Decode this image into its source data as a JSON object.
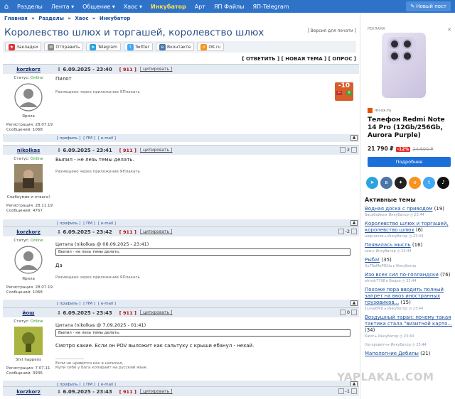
{
  "topbar": {
    "items": [
      "Разделы",
      "Лента ▾",
      "Общение ▾",
      "Хаос ▾",
      "Инкубатор",
      "Арт",
      "ЯП Файлы",
      "ЯП-Telegram"
    ],
    "new_post": "Новый пост",
    "highlight_color": "#ffe14d",
    "bar_color": "#2f73c9"
  },
  "breadcrumbs": [
    "Главная",
    "»",
    "Разделы",
    "»",
    "Хаос",
    "»",
    "Инкубатор"
  ],
  "thread": {
    "title": "Королевство шлюх и торгашей, королевство шлюх",
    "print_link": "[ Версия для печати ]"
  },
  "share": [
    "Закладки",
    "Отправить",
    "Telegram",
    "Twitter",
    "Вконтакте",
    "OK.ru"
  ],
  "actions": "[ ОТВЕТИТЬ ] [ НОВАЯ ТЕМА ] [ ОПРОС ]",
  "posts": [
    {
      "user": "korzkorz",
      "date": "6.09.2025 - 23:40",
      "num": "[ 911 ]",
      "quote_btn": "[ цитировать ]",
      "status_label": "Статус:",
      "status": "Online",
      "caption": "Ярила",
      "reg": "Регистрация: 28.07.19",
      "msgs": "Сообщений: 1068",
      "text": "Пилот",
      "via": "Размещено через приложение  ЯПлакать",
      "rating": "-10"
    },
    {
      "user": "nikolkas",
      "date": "6.09.2025 - 23:41",
      "num": "[ 911 ]",
      "quote_btn": "[ цитировать ]",
      "status_label": "Статус:",
      "status": "Online",
      "caption": "Слабоумие и отвага!",
      "reg": "Регистрация: 28.11.19",
      "msgs": "Сообщений: 4767",
      "text": "Выпил - не лезь темы делать.",
      "via": "Размещено через приложение  ЯПлакать",
      "rating": "2"
    },
    {
      "user": "korzkorz",
      "date": "6.09.2025 - 23:42",
      "num": "[ 911 ]",
      "quote_btn": "[ цитировать ]",
      "status_label": "Статус:",
      "status": "Online",
      "caption": "Ярила",
      "reg": "Регистрация: 28.07.19",
      "msgs": "Сообщений: 1068",
      "quote_head": "Цитата (nikolkas @ 06.09.2025 - 23:41)",
      "quote_text": "Выпил - не лезь темы делать.",
      "text": "Да",
      "via": "Размещено через приложение  ЯПлакать",
      "rating": "-2"
    },
    {
      "user": "йош",
      "date": "6.09.2025 - 23:43",
      "num": "[ 911 ]",
      "quote_btn": "[ цитировать ]",
      "status_label": "Статус:",
      "status": "Online",
      "caption": "Shit happens",
      "reg": "Регистрация: 7.07.11",
      "msgs": "Сообщений: 3936",
      "quote_head": "Цитата (nikolkas @ 7.09.2025 - 01:41)",
      "quote_text": "Выпил - не лезь темы делать.",
      "text": "Смотря какие. Если он POV выложит как сальтуху с крыши ебанул - нехай.",
      "sig1": "--------------------",
      "sig2": "Если не нравится как я написал,",
      "sig3": "Купи себе у Бога копирайт на русский язык.",
      "rating": "0"
    },
    {
      "user": "korzkorz",
      "date": "6.09.2025 - 23:43",
      "num": "[ 911 ]",
      "quote_btn": "[ цитировать ]",
      "rating": "-1"
    }
  ],
  "footer_links": [
    "[ профиль ]",
    "[ ПМ ]",
    "[ e-mail ]"
  ],
  "ad": {
    "label": "РЕКЛАМА",
    "close": "✕",
    "brand": "mi-xx.ru",
    "title": "Телефон Redmi Note 14 Pro (12Gb/256Gb, Aurora Purple)",
    "price": "21 790 ₽",
    "discount": "-12%",
    "old_price": "24 690 ₽",
    "button": "Подробнее"
  },
  "active": {
    "heading": "Активные темы",
    "topics": [
      {
        "title": "Водная доска с приводом",
        "count": "(19)",
        "meta": "Басабайка ▸ Инкубатор ◷ 23:44"
      },
      {
        "title": "Королевство шлюх и торгашей, королевство шлюх",
        "count": "(6)",
        "meta": "ширчинов ▸ Инкубатор ◷ 23:44"
      },
      {
        "title": "Появилась мысль",
        "count": "(16)",
        "meta": "xzw ▸ Инкубатор ◷ 23:44"
      },
      {
        "title": "Рыба!",
        "count": "(35)",
        "meta": "XuTRoMoPDiUu ▸ Инкубатор"
      },
      {
        "title": "Изо всех сил по-голландски",
        "count": "(76)",
        "meta": "etmnk7798 ▸ Видео ◷ 23:44"
      },
      {
        "title": "Похоже пора вводить полный запрет на ввоз иностранных грузовиков...",
        "count": "(15)",
        "meta": "1LoveEMD ▸ Инкубатор ◷ 23:44"
      },
      {
        "title": "Воздушный таран: почему такая тактика стала \"визитной карто...",
        "count": "(34)",
        "meta": "Kator ▸ Инкубатор ◷ 23:44"
      },
      {
        "title": "",
        "count": "",
        "meta": "Нагоровитч ▸ Инкубатор ◷ 23:44"
      },
      {
        "title": "Мапологние Дебилы",
        "count": "(21)",
        "meta": ""
      }
    ]
  },
  "watermark": "YAPLAKAL.COM"
}
